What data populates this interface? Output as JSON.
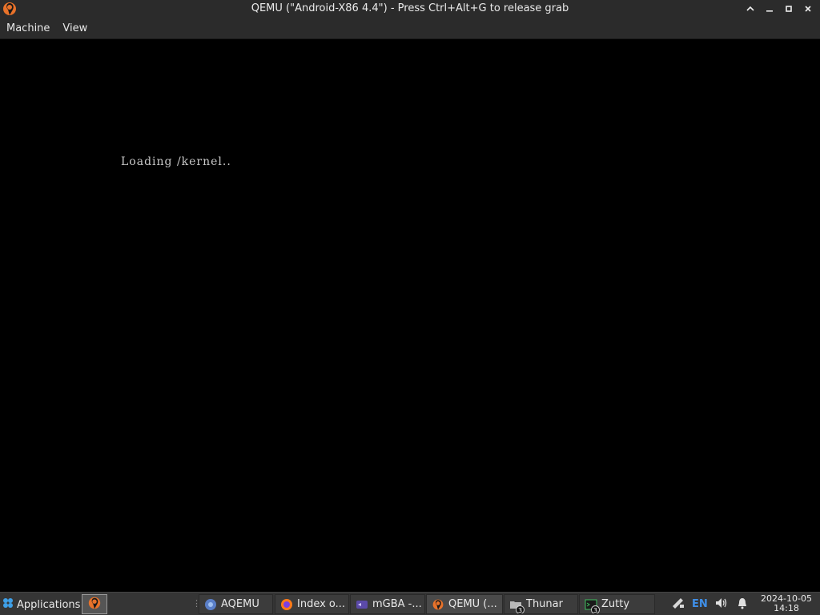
{
  "window": {
    "title": "QEMU (\"Android-X86 4.4\") - Press Ctrl+Alt+G to release grab",
    "app_icon": "qemu-icon",
    "controls": [
      "chevron-up-icon",
      "minimize-icon",
      "maximize-icon",
      "close-icon"
    ]
  },
  "menubar": {
    "machine": "Machine",
    "view": "View"
  },
  "vm": {
    "boot_text": "Loading /kernel.."
  },
  "taskbar": {
    "applications_label": "Applications",
    "tasks": [
      {
        "label": "AQEMU",
        "icon": "aqemu-icon"
      },
      {
        "label": "Index o...",
        "icon": "firefox-icon"
      },
      {
        "label": "mGBA -...",
        "icon": "mgba-icon"
      },
      {
        "label": "QEMU (...",
        "icon": "qemu-icon"
      },
      {
        "label": "Thunar",
        "icon": "folder-icon",
        "badge": "3"
      },
      {
        "label": "Zutty",
        "icon": "terminal-icon",
        "badge": "3"
      }
    ],
    "tray": {
      "keyboard_layout": "EN",
      "icons": [
        "network-icon",
        "volume-icon",
        "notification-bell-icon"
      ]
    },
    "clock": {
      "date": "2024-10-05",
      "time": "14:18"
    }
  },
  "colors": {
    "titlebar_bg": "#2b2b2b",
    "taskbar_bg": "#353535",
    "screen_bg": "#000000",
    "layout_indicator": "#3f8fe8"
  }
}
